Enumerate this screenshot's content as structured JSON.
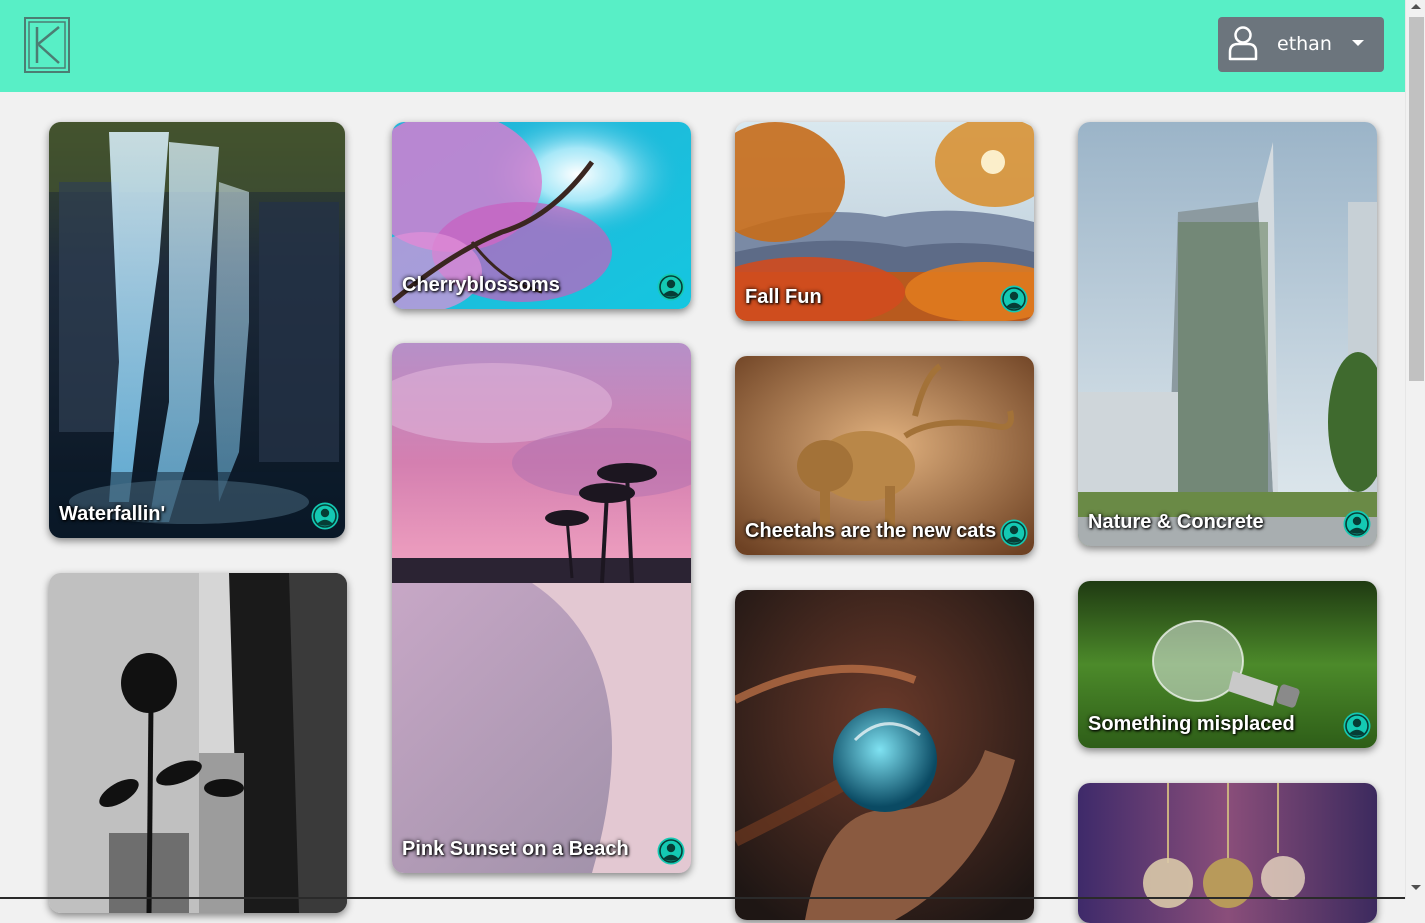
{
  "header": {
    "logo": "K-logo",
    "user_menu": {
      "username": "ethan",
      "icon": "user-icon",
      "caret": "caret-down-icon"
    }
  },
  "colors": {
    "header_bg": "#58efc6",
    "page_bg": "#f1f1f1",
    "user_menu_bg": "#6c757d",
    "avatar_accent": "#14c9b3"
  },
  "cards": [
    {
      "title": "Waterfallin'",
      "icon": "author-avatar-icon"
    },
    {
      "title": "Cherryblossoms",
      "icon": "author-avatar-icon"
    },
    {
      "title": "Fall Fun",
      "icon": "author-avatar-icon"
    },
    {
      "title": "Nature & Concrete",
      "icon": "author-avatar-icon"
    },
    {
      "title": "Pink Sunset on a Beach",
      "icon": "author-avatar-icon"
    },
    {
      "title": "Cheetahs are the new cats",
      "icon": "author-avatar-icon"
    },
    {
      "title": "Something misplaced",
      "icon": "author-avatar-icon"
    },
    {
      "title": "",
      "icon": ""
    },
    {
      "title": "",
      "icon": ""
    },
    {
      "title": "",
      "icon": ""
    }
  ]
}
